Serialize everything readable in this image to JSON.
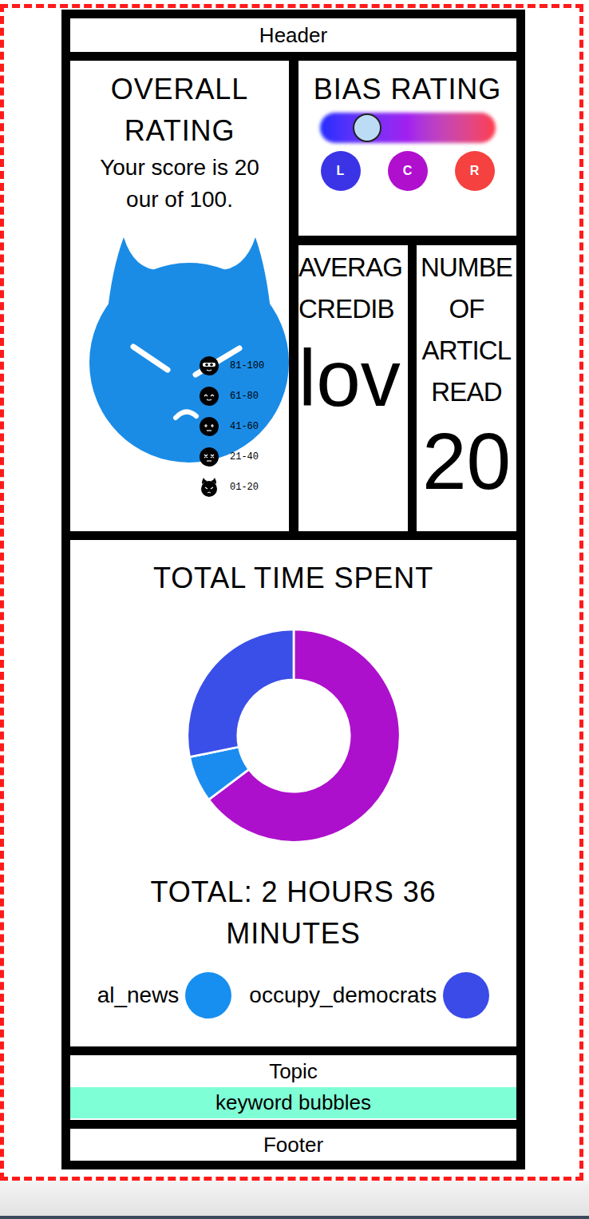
{
  "header": "Header",
  "overall": {
    "title_lines": [
      "OVERALL",
      "RATING"
    ],
    "score_lines": [
      "Your score is 20",
      "our of 100."
    ],
    "legend": [
      {
        "label": "81-100",
        "kind": "sunglasses"
      },
      {
        "label": "61-80",
        "kind": "happy"
      },
      {
        "label": "41-60",
        "kind": "neutral"
      },
      {
        "label": "21-40",
        "kind": "dead"
      },
      {
        "label": "01-20",
        "kind": "devil"
      }
    ]
  },
  "bias": {
    "title": "BIAS RATING",
    "level": 0.27,
    "options": [
      {
        "label": "L",
        "color": "#3b34e6"
      },
      {
        "label": "C",
        "color": "#b10fce"
      },
      {
        "label": "R",
        "color": "#f5413f"
      }
    ]
  },
  "credibility": {
    "title_lines": [
      "AVERAG",
      "CREDIB"
    ],
    "value": "lov"
  },
  "articles": {
    "title_lines": [
      "NUMBE",
      "OF",
      "ARTICL",
      "READ"
    ],
    "value": "20"
  },
  "time": {
    "title": "TOTAL TIME SPENT",
    "chart": {
      "segments": [
        {
          "value": 101,
          "color": "#ad10cc"
        },
        {
          "value": 11,
          "color": "#1a8cf0"
        },
        {
          "value": 44,
          "color": "#3a4ee8"
        }
      ]
    },
    "total_lines": [
      "TOTAL: 2 HOURS 36",
      "MINUTES"
    ],
    "legend": [
      {
        "label": "al_news",
        "color": "#168ff0"
      },
      {
        "label": "occupy_democrats",
        "color": "#3a4be8"
      }
    ]
  },
  "topic": {
    "title": "Topic",
    "keywords": "keyword bubbles"
  },
  "footer": "Footer"
}
